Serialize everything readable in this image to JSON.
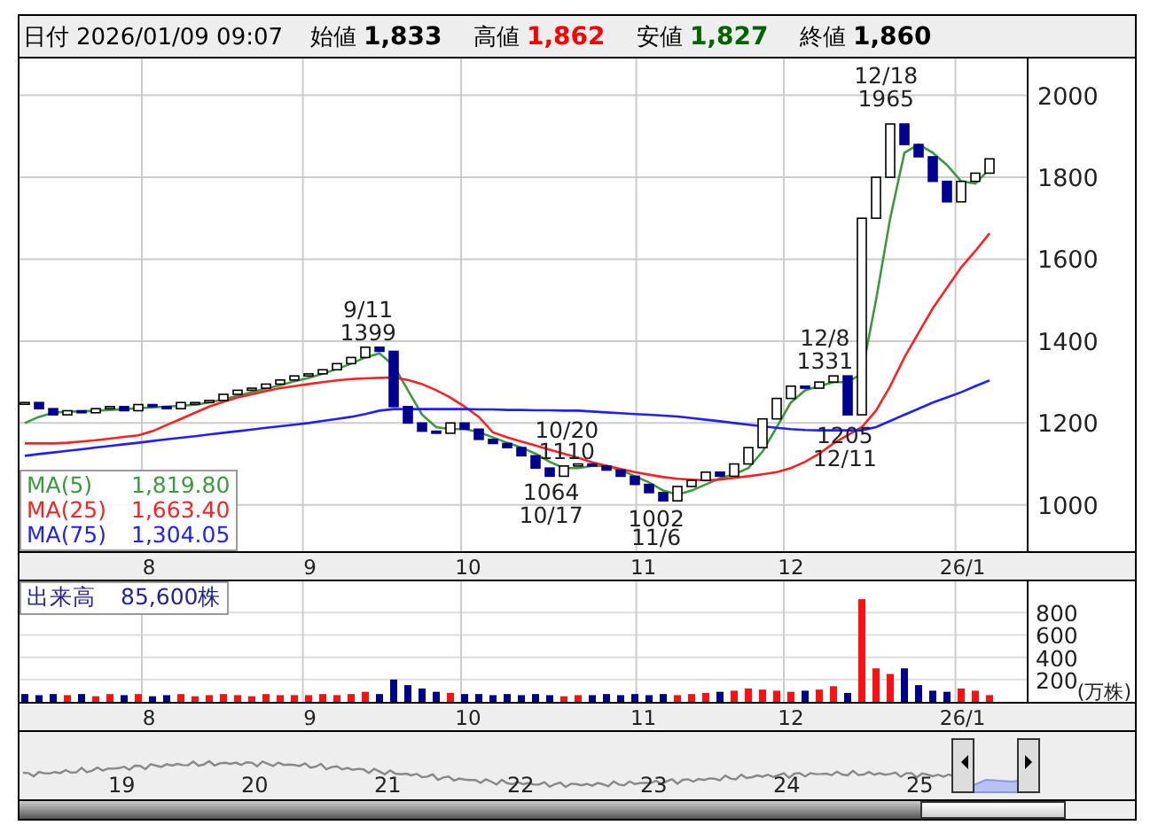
{
  "quote_header": {
    "date_label": "日付",
    "datetime": "2026/01/09 09:07",
    "fields": [
      {
        "label": "始値",
        "value": "1,833",
        "color": "#000000"
      },
      {
        "label": "高値",
        "value": "1,862",
        "color": "#ff0000"
      },
      {
        "label": "安値",
        "value": "1,827",
        "color": "#006400"
      },
      {
        "label": "終値",
        "value": "1,860",
        "color": "#000000"
      }
    ]
  },
  "price_chart": {
    "month_labels": [
      "8",
      "9",
      "10",
      "11",
      "12",
      "26/1"
    ],
    "legend_values": [
      "1,819.80",
      "1,663.40",
      "1,304.05"
    ],
    "chart_data": {
      "type": "line",
      "grid": true,
      "ylim": [
        887,
        2090
      ],
      "yticks": [
        1000,
        1200,
        1400,
        1600,
        1800,
        2000
      ],
      "series": [
        {
          "name": "MA(5)",
          "color": "#3c9a3c",
          "values": [
            1200,
            1215,
            1225,
            1228,
            1228,
            1230,
            1232,
            1234,
            1236,
            1238,
            1240,
            1242,
            1245,
            1250,
            1258,
            1266,
            1275,
            1284,
            1292,
            1302,
            1310,
            1320,
            1332,
            1345,
            1360,
            1370,
            1340,
            1280,
            1220,
            1190,
            1185,
            1185,
            1178,
            1165,
            1152,
            1140,
            1125,
            1105,
            1090,
            1090,
            1095,
            1095,
            1085,
            1070,
            1055,
            1035,
            1025,
            1035,
            1050,
            1065,
            1075,
            1090,
            1130,
            1190,
            1250,
            1280,
            1290,
            1300,
            1300,
            1320,
            1500,
            1700,
            1860,
            1880,
            1860,
            1830,
            1790,
            1785,
            1820
          ]
        },
        {
          "name": "MA(25)",
          "color": "#ff2020",
          "values": [
            1150,
            1150,
            1150,
            1152,
            1155,
            1158,
            1162,
            1166,
            1170,
            1180,
            1195,
            1210,
            1225,
            1240,
            1252,
            1262,
            1270,
            1278,
            1285,
            1290,
            1295,
            1300,
            1304,
            1307,
            1309,
            1310,
            1311,
            1305,
            1295,
            1280,
            1262,
            1240,
            1215,
            1177,
            1165,
            1155,
            1145,
            1135,
            1125,
            1115,
            1104,
            1096,
            1088,
            1080,
            1074,
            1068,
            1064,
            1062,
            1060,
            1062,
            1066,
            1070,
            1075,
            1080,
            1090,
            1105,
            1125,
            1150,
            1170,
            1190,
            1230,
            1290,
            1360,
            1420,
            1480,
            1530,
            1580,
            1620,
            1663
          ]
        },
        {
          "name": "MA(75)",
          "color": "#2020ff",
          "values": [
            1120,
            1124,
            1128,
            1132,
            1136,
            1140,
            1144,
            1148,
            1152,
            1156,
            1160,
            1164,
            1168,
            1172,
            1176,
            1180,
            1184,
            1188,
            1192,
            1196,
            1200,
            1205,
            1210,
            1215,
            1222,
            1230,
            1234,
            1234,
            1234,
            1234,
            1234,
            1234,
            1233,
            1233,
            1232,
            1232,
            1231,
            1231,
            1230,
            1230,
            1228,
            1226,
            1224,
            1222,
            1220,
            1218,
            1216,
            1212,
            1208,
            1204,
            1200,
            1196,
            1192,
            1188,
            1185,
            1183,
            1182,
            1182,
            1182,
            1182,
            1190,
            1205,
            1220,
            1235,
            1250,
            1262,
            1275,
            1290,
            1304
          ]
        }
      ],
      "annotations": [
        "9/11",
        "1399",
        "10/20",
        "1110",
        "1064",
        "10/17",
        "1002",
        "11/6",
        "12/8",
        "1331",
        "1205",
        "12/11",
        "12/18",
        "1965"
      ]
    }
  },
  "volume_chart": {
    "month_labels": [
      "8",
      "9",
      "10",
      "11",
      "12",
      "26/1"
    ],
    "legend_label": "出来高",
    "legend_value": "85,600株",
    "chart_data": {
      "type": "bar",
      "grid": true,
      "ylim": [
        0,
        1080
      ],
      "yticks": [
        200,
        400,
        600,
        800
      ],
      "ylabel": "(万株)",
      "values": [
        70,
        60,
        70,
        60,
        70,
        50,
        70,
        60,
        70,
        50,
        60,
        70,
        50,
        60,
        70,
        60,
        50,
        70,
        60,
        60,
        60,
        70,
        60,
        70,
        90,
        70,
        200,
        150,
        120,
        90,
        80,
        70,
        70,
        60,
        70,
        60,
        70,
        60,
        50,
        60,
        60,
        70,
        60,
        70,
        60,
        70,
        60,
        70,
        80,
        90,
        100,
        120,
        110,
        100,
        90,
        100,
        110,
        140,
        80,
        920,
        300,
        250,
        300,
        150,
        100,
        90,
        120,
        100,
        60
      ]
    }
  },
  "navigator": {
    "labels": [
      "19",
      "20",
      "21",
      "22",
      "23",
      "24",
      "25"
    ]
  }
}
